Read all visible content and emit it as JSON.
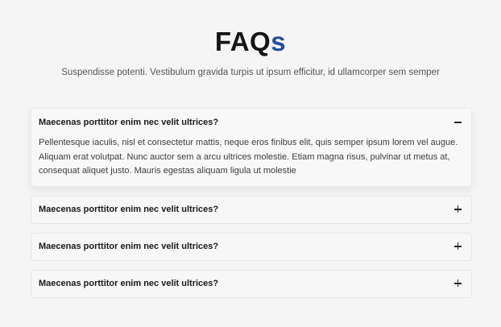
{
  "header": {
    "title_main": "FAQ",
    "title_accent": "s",
    "subtitle": "Suspendisse potenti. Vestibulum gravida turpis ut ipsum efficitur, id ullamcorper sem semper"
  },
  "colors": {
    "accent": "#1f4fa0",
    "background": "#f5f5f5"
  },
  "faqs": [
    {
      "question": "Maecenas porttitor enim nec velit ultrices?",
      "answer": "Pellentesque iaculis, nisl et consectetur mattis, neque eros finibus elit, quis semper ipsum lorem vel augue. Aliquam erat volutpat. Nunc auctor sem a arcu ultrices molestie. Etiam magna risus, pulvinar ut metus at, consequat aliquet justo. Mauris egestas aliquam ligula ut molestie",
      "expanded": true,
      "toggle_icon": "minus-icon"
    },
    {
      "question": "Maecenas porttitor enim nec velit ultrices?",
      "expanded": false,
      "toggle_icon": "plus-icon"
    },
    {
      "question": "Maecenas porttitor enim nec velit ultrices?",
      "expanded": false,
      "toggle_icon": "plus-icon"
    },
    {
      "question": "Maecenas porttitor enim nec velit ultrices?",
      "expanded": false,
      "toggle_icon": "plus-icon"
    }
  ]
}
